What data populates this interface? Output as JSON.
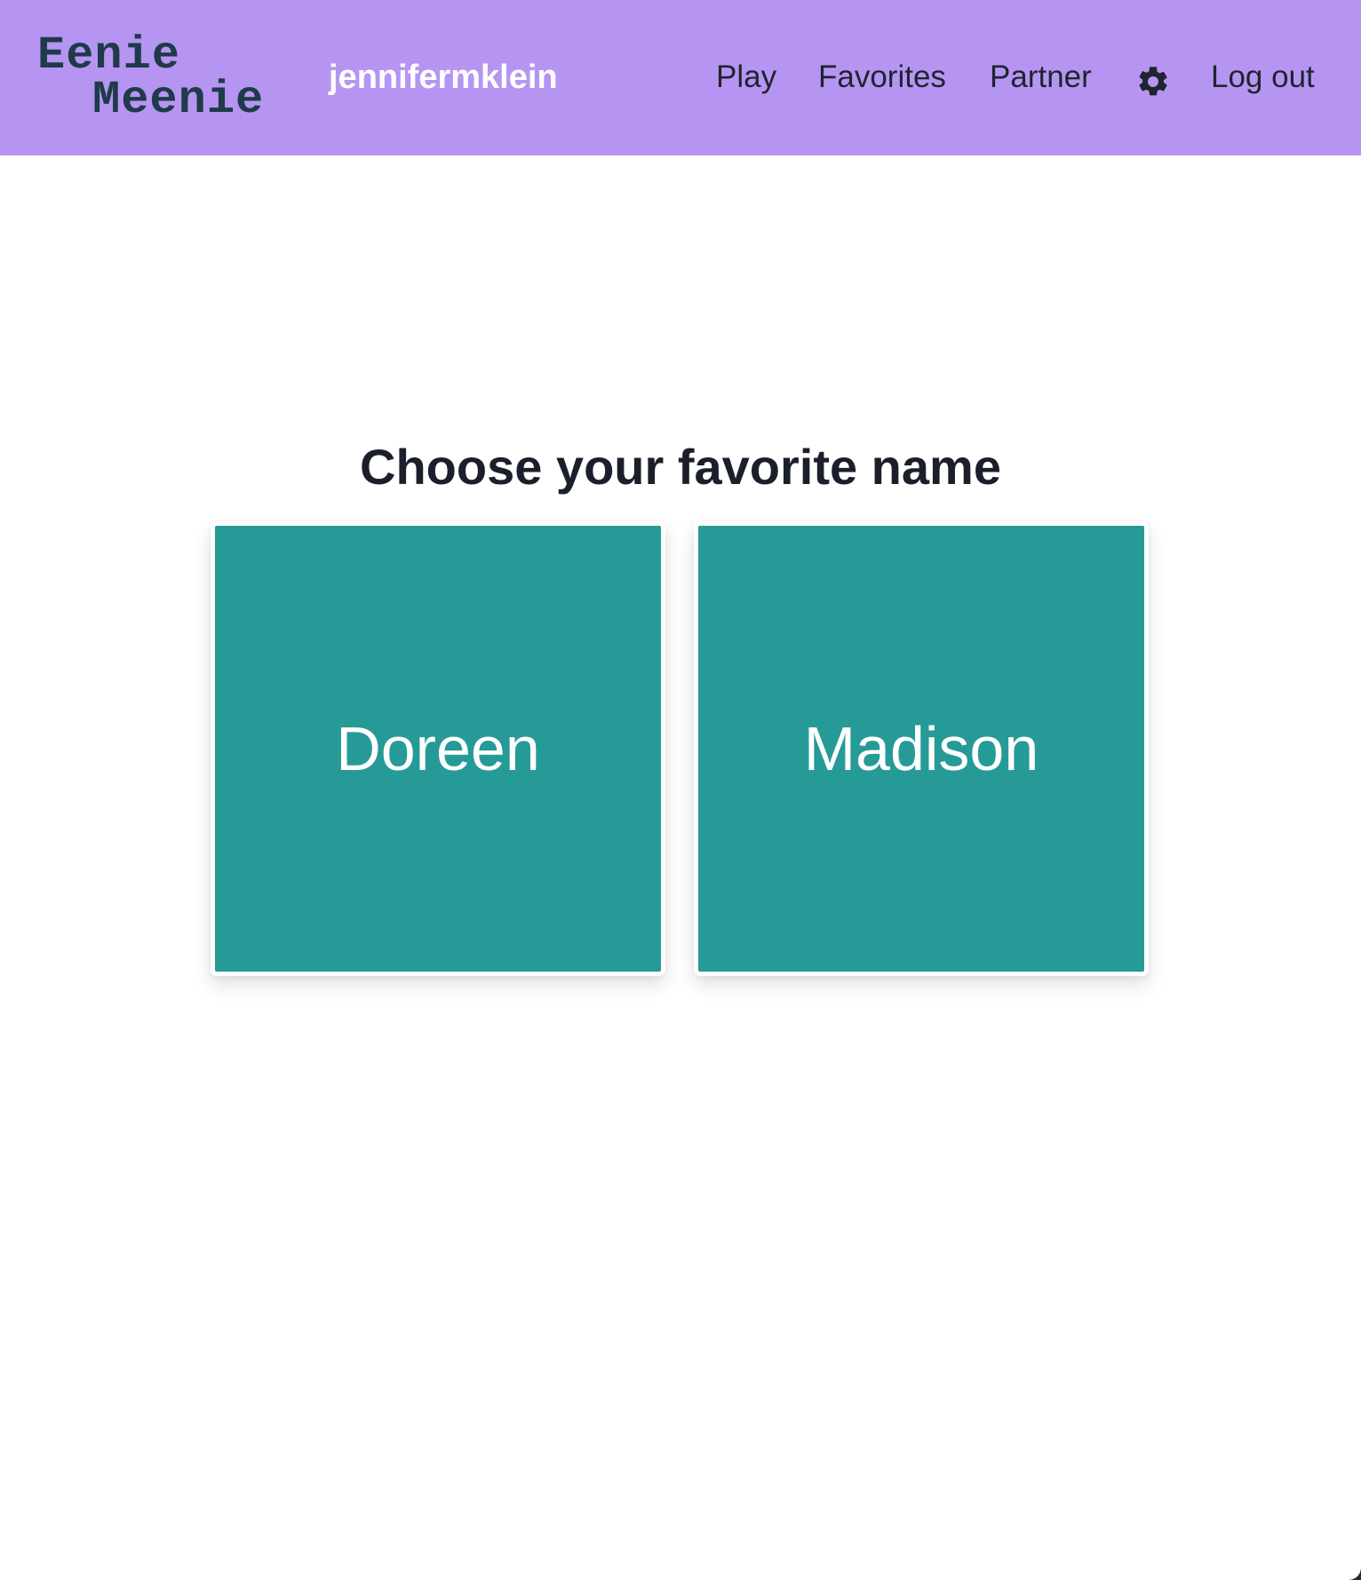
{
  "app": {
    "logo_line1": "Eenie",
    "logo_line2": "Meenie",
    "username": "jennifermklein"
  },
  "nav": {
    "play": "Play",
    "favorites": "Favorites",
    "partner": "Partner",
    "settings_icon": "gear-icon",
    "logout": "Log out"
  },
  "main": {
    "heading": "Choose your favorite name",
    "choices": [
      {
        "name": "Doreen"
      },
      {
        "name": "Madison"
      }
    ]
  },
  "colors": {
    "navbar": "#b695f2",
    "card": "#269a96",
    "logo": "#1f3a48",
    "heading": "#1b1f2b"
  }
}
